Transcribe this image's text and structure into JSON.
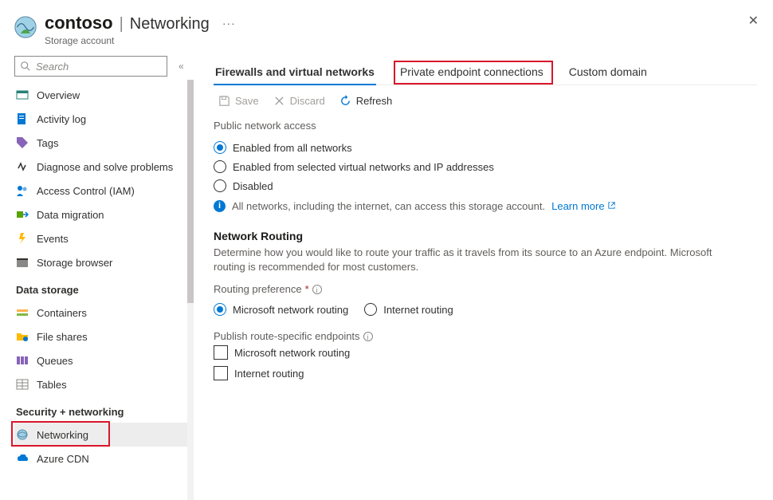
{
  "header": {
    "title": "contoso",
    "section": "Networking",
    "subtitle": "Storage account"
  },
  "search": {
    "placeholder": "Search"
  },
  "sidebar": {
    "items": [
      {
        "label": "Overview",
        "icon": "overview"
      },
      {
        "label": "Activity log",
        "icon": "log"
      },
      {
        "label": "Tags",
        "icon": "tags"
      },
      {
        "label": "Diagnose and solve problems",
        "icon": "diag"
      },
      {
        "label": "Access Control (IAM)",
        "icon": "iam"
      },
      {
        "label": "Data migration",
        "icon": "migrate"
      },
      {
        "label": "Events",
        "icon": "events"
      },
      {
        "label": "Storage browser",
        "icon": "browser"
      }
    ],
    "groups": [
      {
        "label": "Data storage",
        "items": [
          {
            "label": "Containers",
            "icon": "containers"
          },
          {
            "label": "File shares",
            "icon": "fileshares"
          },
          {
            "label": "Queues",
            "icon": "queues"
          },
          {
            "label": "Tables",
            "icon": "tables"
          }
        ]
      },
      {
        "label": "Security + networking",
        "items": [
          {
            "label": "Networking",
            "icon": "networking",
            "selected": true
          },
          {
            "label": "Azure CDN",
            "icon": "cdn"
          }
        ]
      }
    ]
  },
  "tabs": {
    "t0": "Firewalls and virtual networks",
    "t1": "Private endpoint connections",
    "t2": "Custom domain"
  },
  "toolbar": {
    "save": "Save",
    "discard": "Discard",
    "refresh": "Refresh"
  },
  "publicAccess": {
    "label": "Public network access",
    "opt0": "Enabled from all networks",
    "opt1": "Enabled from selected virtual networks and IP addresses",
    "opt2": "Disabled",
    "info": "All networks, including the internet, can access this storage account.",
    "learn": "Learn more"
  },
  "routing": {
    "heading": "Network Routing",
    "desc": "Determine how you would like to route your traffic as it travels from its source to an Azure endpoint. Microsoft routing is recommended for most customers.",
    "prefLabel": "Routing preference",
    "opt0": "Microsoft network routing",
    "opt1": "Internet routing",
    "publishLabel": "Publish route-specific endpoints",
    "cb0": "Microsoft network routing",
    "cb1": "Internet routing"
  }
}
